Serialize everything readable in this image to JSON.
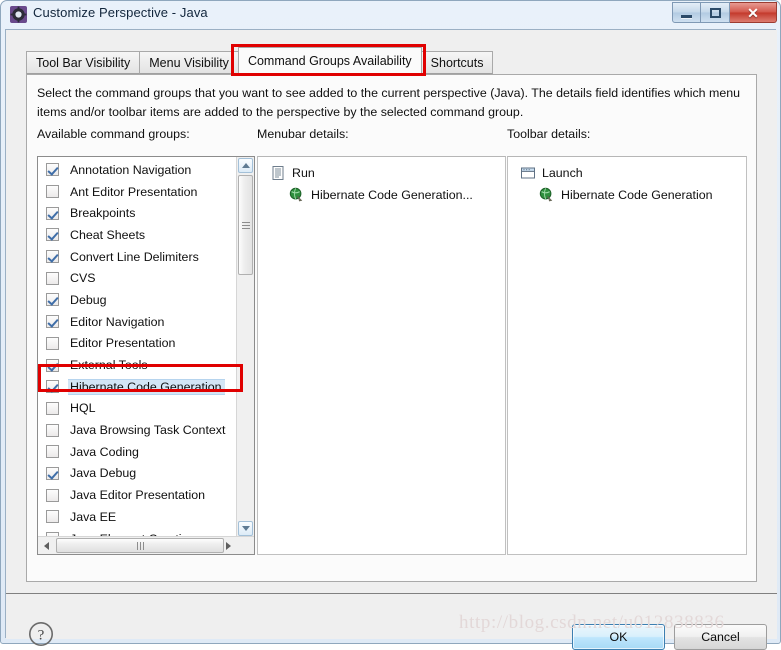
{
  "window": {
    "title": "Customize Perspective - Java",
    "icon": "perspective-gear-icon",
    "minimize_label": "Minimize",
    "maximize_label": "Maximize",
    "close_label": "Close"
  },
  "tabs": [
    {
      "label": "Tool Bar Visibility",
      "selected": false
    },
    {
      "label": "Menu Visibility",
      "selected": false
    },
    {
      "label": "Command Groups Availability",
      "selected": true
    },
    {
      "label": "Shortcuts",
      "selected": false
    }
  ],
  "description": "Select the command groups that you want to see added to the current perspective (Java).  The details field identifies which menu items and/or toolbar items are added to the perspective by the selected command group.",
  "columns": {
    "available": "Available command groups:",
    "menubar": "Menubar details:",
    "toolbar": "Toolbar details:"
  },
  "available_command_groups": [
    {
      "label": "Annotation Navigation",
      "checked": true,
      "selected": false
    },
    {
      "label": "Ant Editor Presentation",
      "checked": false,
      "selected": false
    },
    {
      "label": "Breakpoints",
      "checked": true,
      "selected": false
    },
    {
      "label": "Cheat Sheets",
      "checked": true,
      "selected": false
    },
    {
      "label": "Convert Line Delimiters",
      "checked": true,
      "selected": false
    },
    {
      "label": "CVS",
      "checked": false,
      "selected": false
    },
    {
      "label": "Debug",
      "checked": true,
      "selected": false
    },
    {
      "label": "Editor Navigation",
      "checked": true,
      "selected": false
    },
    {
      "label": "Editor Presentation",
      "checked": false,
      "selected": false
    },
    {
      "label": "External Tools",
      "checked": true,
      "selected": false
    },
    {
      "label": "Hibernate Code Generation",
      "checked": true,
      "selected": true
    },
    {
      "label": "HQL",
      "checked": false,
      "selected": false
    },
    {
      "label": "Java Browsing Task Context",
      "checked": false,
      "selected": false
    },
    {
      "label": "Java Coding",
      "checked": false,
      "selected": false
    },
    {
      "label": "Java Debug",
      "checked": true,
      "selected": false
    },
    {
      "label": "Java Editor Presentation",
      "checked": false,
      "selected": false
    },
    {
      "label": "Java EE",
      "checked": false,
      "selected": false
    },
    {
      "label": "Java Element Creation",
      "checked": true,
      "selected": false
    }
  ],
  "menubar_details": [
    {
      "label": "Run",
      "icon": "menu-document-icon",
      "level": "root"
    },
    {
      "label": "Hibernate Code Generation...",
      "icon": "hibernate-globe-icon",
      "level": "child"
    }
  ],
  "toolbar_details": [
    {
      "label": "Launch",
      "icon": "toolbar-window-icon",
      "level": "root"
    },
    {
      "label": "Hibernate Code Generation",
      "icon": "hibernate-globe-icon",
      "level": "child"
    }
  ],
  "footer": {
    "help": "?",
    "ok": "OK",
    "cancel": "Cancel"
  },
  "watermark": "http://blog.csdn.net/u012838836",
  "colors": {
    "annotation_red": "#e00000",
    "selection_blue": "#d3e5f5",
    "dialog_background": "#efefef",
    "panel_background": "#fbfbfb",
    "ok_button_blue": "#bee6fd"
  }
}
